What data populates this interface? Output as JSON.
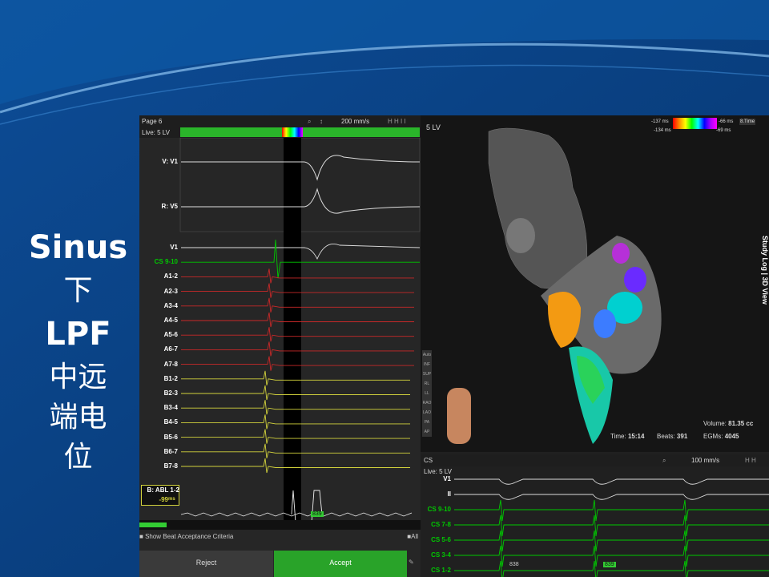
{
  "side_title": {
    "line1": "Sinus",
    "line2": "下",
    "line3": "LPF",
    "line4": "中远",
    "line5": "端电",
    "line6": "位"
  },
  "left_panel": {
    "page": "Page 6",
    "live": "Live: 5 LV",
    "speed": "200 mm/s",
    "surface_labels": [
      "V: V1",
      "R: V5"
    ],
    "channels": [
      "V1",
      "CS 9-10",
      "A1-2",
      "A2-3",
      "A3-4",
      "A4-5",
      "A5-6",
      "A6-7",
      "A7-8",
      "B1-2",
      "B2-3",
      "B3-4",
      "B4-5",
      "B5-6",
      "B6-7",
      "B7-8"
    ],
    "v1_suffix": "V",
    "abl_label": "B: ABL 1-2",
    "abl_value": "-99",
    "abl_unit": "ms",
    "marker": "839",
    "show_beat": "Show Beat Acceptance Criteria",
    "all": "All",
    "reject": "Reject",
    "accept": "Accept"
  },
  "map_panel": {
    "label": "5 LV",
    "legend_tl": "-137 ms",
    "legend_bl": "-134 ms",
    "legend_tr": "-66 ms",
    "legend_br": "-69 ms",
    "time_menu": "8.Time",
    "time_label": "Time:",
    "time_value": "15:14",
    "beats_label": "Beats:",
    "beats_value": "391",
    "volume_label": "Volume:",
    "volume_value": "81.35 cc",
    "egms_label": "EGMs:",
    "egms_value": "4045",
    "side_tab": "Study Log | 3D View",
    "view_buttons": [
      "Auto",
      "INF",
      "SUP",
      "RL",
      "LL",
      "RAO",
      "LAO",
      "PA",
      "AP"
    ]
  },
  "bottom_panel": {
    "label": "CS",
    "live": "Live: 5 LV",
    "speed": "100 mm/s",
    "channels": [
      "V1",
      "II",
      "CS 9-10",
      "CS 7-8",
      "CS 5-6",
      "CS 3-4",
      "CS 1-2"
    ],
    "v1_suffix": "V",
    "marker1": "838",
    "marker2": "839"
  },
  "colors": {
    "green": "#00c800",
    "red": "#c82828",
    "yellow": "#d2d23c",
    "accept": "#29a329"
  }
}
